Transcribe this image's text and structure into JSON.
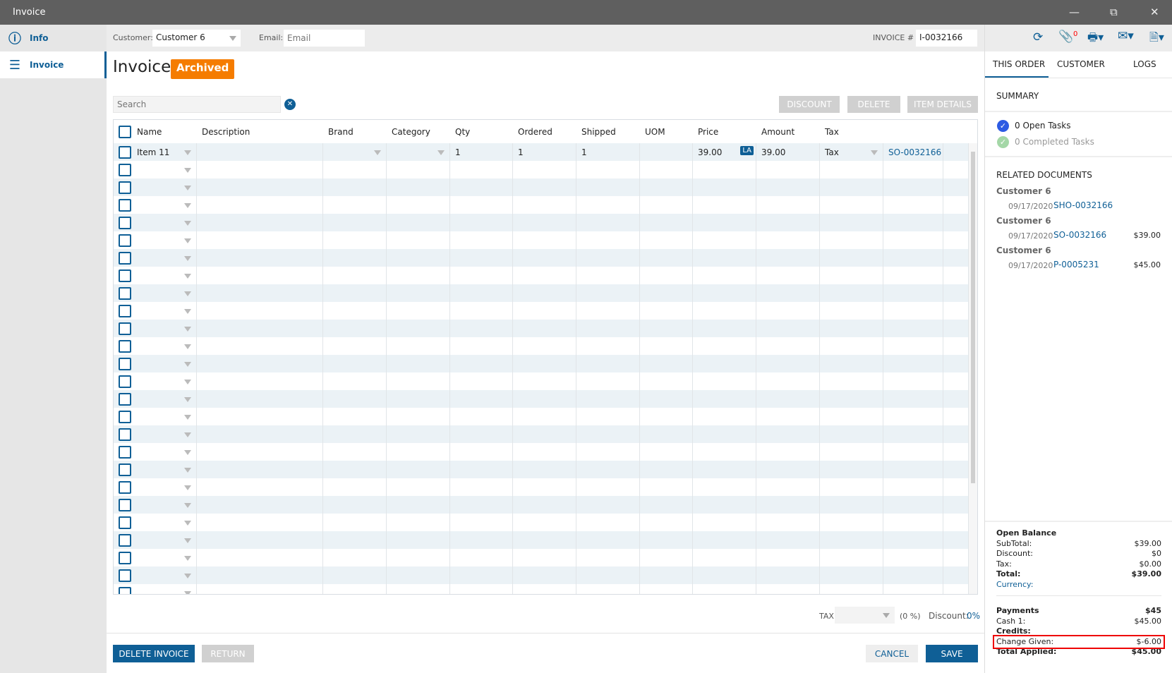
{
  "window": {
    "title": "Invoice"
  },
  "sidebar": {
    "items": [
      {
        "label": "Info",
        "icon": "info-icon"
      },
      {
        "label": "Invoice",
        "icon": "list-icon"
      }
    ]
  },
  "toolbar": {
    "customer_label": "Customer:",
    "customer_value": "Customer 6",
    "email_label": "Email:",
    "email_placeholder": "Email",
    "invoice_label": "INVOICE #",
    "invoice_value": "I-0032166",
    "attachments_count": "0"
  },
  "page": {
    "title": "Invoice",
    "status": "Archived",
    "status_color": "#f57c00",
    "search_placeholder": "Search"
  },
  "actions": {
    "discount": "DISCOUNT",
    "delete": "DELETE",
    "item_details": "ITEM DETAILS"
  },
  "table": {
    "columns": [
      "Name",
      "Description",
      "Brand",
      "Category",
      "Qty",
      "Ordered",
      "Shipped",
      "UOM",
      "Price",
      "Amount",
      "Tax"
    ],
    "rows": [
      {
        "name": "Item 11",
        "description": "",
        "brand": "",
        "category": "",
        "qty": "1",
        "ordered": "1",
        "shipped": "1",
        "uom": "",
        "price": "39.00",
        "price_badge": "LA",
        "amount": "39.00",
        "tax": "Tax",
        "link": "SO-0032166"
      }
    ]
  },
  "footer": {
    "tax_label": "TAX",
    "tax_pct": "(0 %)",
    "discount_label": "Discount:",
    "discount_value": "0%",
    "delete_invoice": "DELETE INVOICE",
    "return": "RETURN",
    "cancel": "CANCEL",
    "save": "SAVE"
  },
  "right": {
    "tabs": [
      "THIS ORDER",
      "CUSTOMER",
      "LOGS"
    ],
    "summary_title": "SUMMARY",
    "open_tasks": "0 Open Tasks",
    "completed_tasks": "0 Completed Tasks",
    "related_title": "RELATED DOCUMENTS",
    "related": [
      {
        "customer": "Customer 6",
        "date": "09/17/2020",
        "doc": "SHO-0032166",
        "amount": ""
      },
      {
        "customer": "Customer 6",
        "date": "09/17/2020",
        "doc": "SO-0032166",
        "amount": "$39.00"
      },
      {
        "customer": "Customer 6",
        "date": "09/17/2020",
        "doc": "P-0005231",
        "amount": "$45.00"
      }
    ],
    "balance": {
      "title": "Open Balance",
      "subtotal_label": "SubTotal:",
      "subtotal": "$39.00",
      "discount_label": "Discount:",
      "discount": "$0",
      "tax_label": "Tax:",
      "tax": "$0.00",
      "total_label": "Total:",
      "total": "$39.00",
      "currency_label": "Currency:"
    },
    "payments": {
      "title": "Payments",
      "total": "$45",
      "cash_label": "Cash 1:",
      "cash": "$45.00",
      "credits_label": "Credits:",
      "change_label": "Change Given:",
      "change": "$-6.00",
      "applied_label": "Total Applied:",
      "applied": "$45.00"
    }
  }
}
